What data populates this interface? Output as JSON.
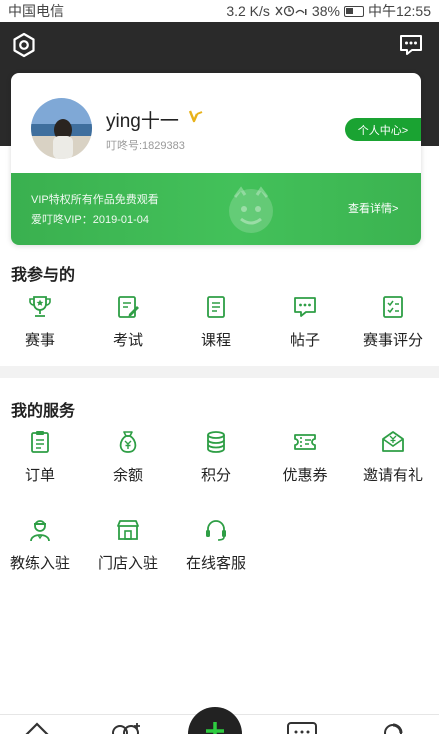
{
  "status_bar": {
    "carrier": "中国电信",
    "speed": "3.2 K/s",
    "battery": "38%",
    "time": "中午12:55"
  },
  "header": {
    "left_icon": "settings-hexagon-icon",
    "right_icon": "message-icon"
  },
  "profile": {
    "username": "ying十一",
    "user_id": "叮咚号:1829383",
    "center_button": "个人中心>",
    "vip_line1": "VIP特权所有作品免费观看",
    "vip_line2": "爱叮咚VIP：2019-01-04",
    "vip_detail": "查看详情>"
  },
  "participated": {
    "title": "我参与的",
    "items": [
      {
        "label": "赛事",
        "icon": "trophy-icon"
      },
      {
        "label": "考试",
        "icon": "exam-edit-icon"
      },
      {
        "label": "课程",
        "icon": "course-doc-icon"
      },
      {
        "label": "帖子",
        "icon": "post-chat-icon"
      },
      {
        "label": "赛事评分",
        "icon": "score-checklist-icon"
      }
    ]
  },
  "services": {
    "title": "我的服务",
    "items": [
      {
        "label": "订单",
        "icon": "order-clipboard-icon"
      },
      {
        "label": "余额",
        "icon": "balance-moneybag-icon"
      },
      {
        "label": "积分",
        "icon": "points-coins-icon"
      },
      {
        "label": "优惠券",
        "icon": "coupon-ticket-icon"
      },
      {
        "label": "邀请有礼",
        "icon": "invite-envelope-icon"
      },
      {
        "label": "教练入驻",
        "icon": "coach-person-icon"
      },
      {
        "label": "门店入驻",
        "icon": "store-icon"
      },
      {
        "label": "在线客服",
        "icon": "support-headset-icon"
      }
    ]
  },
  "colors": {
    "accent": "#1aa332",
    "icon_green": "#2e9e45",
    "header_dark": "#2a2a2a"
  }
}
